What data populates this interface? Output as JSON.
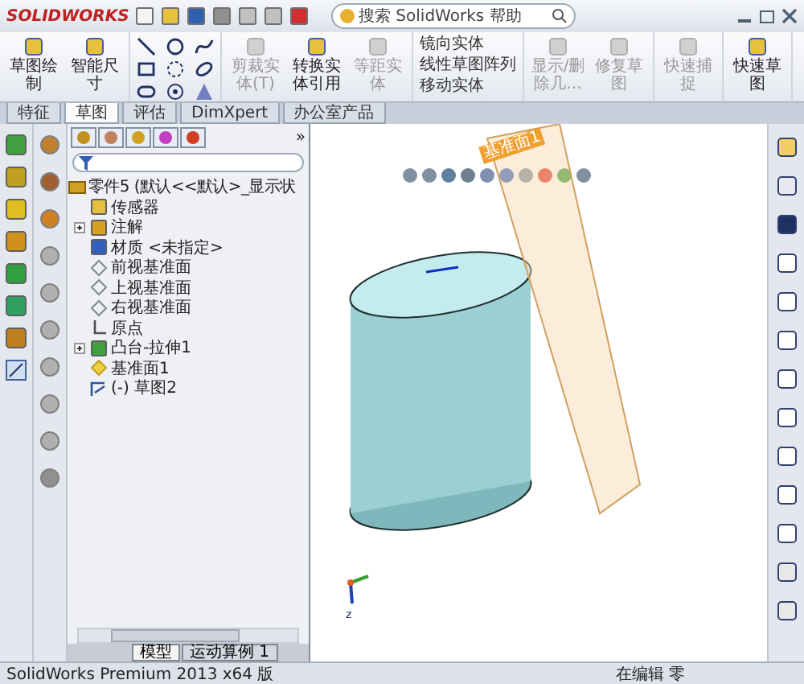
{
  "window": {
    "app_name": "SOLIDWORKS",
    "search": {
      "placeholder": "搜索 SolidWorks 帮助"
    }
  },
  "ribbon": {
    "groups": [
      {
        "kind": "large",
        "buttons": [
          {
            "label": "草图绘制",
            "disabled": false
          },
          {
            "label": "智能尺寸",
            "disabled": false
          }
        ]
      },
      {
        "kind": "grid"
      },
      {
        "kind": "large",
        "buttons": [
          {
            "label": "剪裁实体(T)",
            "disabled": true
          },
          {
            "label": "转换实体引用",
            "disabled": false
          },
          {
            "label": "等距实体",
            "disabled": true
          }
        ]
      },
      {
        "kind": "list",
        "buttons": [
          {
            "label": "镜向实体",
            "disabled": false
          },
          {
            "label": "线性草图阵列",
            "disabled": false
          },
          {
            "label": "移动实体",
            "disabled": false
          }
        ]
      },
      {
        "kind": "large",
        "buttons": [
          {
            "label": "显示/删除几...",
            "disabled": true
          },
          {
            "label": "修复草图",
            "disabled": true
          }
        ]
      },
      {
        "kind": "large",
        "buttons": [
          {
            "label": "快速捕捉",
            "disabled": true
          }
        ]
      },
      {
        "kind": "large",
        "buttons": [
          {
            "label": "快速草图",
            "disabled": false
          }
        ]
      }
    ]
  },
  "tabs": [
    {
      "label": "特征",
      "selected": false
    },
    {
      "label": "草图",
      "selected": true
    },
    {
      "label": "评估",
      "selected": false
    },
    {
      "label": "DimXpert",
      "selected": false
    },
    {
      "label": "办公室产品",
      "selected": false
    }
  ],
  "feature_manager": {
    "more": "»",
    "tree": {
      "label": "零件5 (默认<<默认>_显示状",
      "children": [
        {
          "label": "传感器",
          "kind": "sensor"
        },
        {
          "label": "注解",
          "kind": "annotation",
          "expanded": false
        },
        {
          "label": "材质 <未指定>",
          "kind": "material"
        },
        {
          "label": "前视基准面",
          "kind": "plane"
        },
        {
          "label": "上视基准面",
          "kind": "plane"
        },
        {
          "label": "右视基准面",
          "kind": "plane"
        },
        {
          "label": "原点",
          "kind": "origin"
        },
        {
          "label": "凸台-拉伸1",
          "kind": "feature",
          "expanded": false
        },
        {
          "label": "基准面1",
          "kind": "refplane"
        },
        {
          "label": "(-) 草图2",
          "kind": "sketch"
        }
      ]
    }
  },
  "viewport": {
    "plane_label": "基准面1",
    "triad_axis": "z"
  },
  "bottom_tabs": [
    {
      "label": "模型",
      "selected": true
    },
    {
      "label": "运动算例 1",
      "selected": false
    }
  ],
  "status_bar": {
    "left": "SolidWorks Premium 2013 x64 版",
    "right": "在编辑 零"
  }
}
